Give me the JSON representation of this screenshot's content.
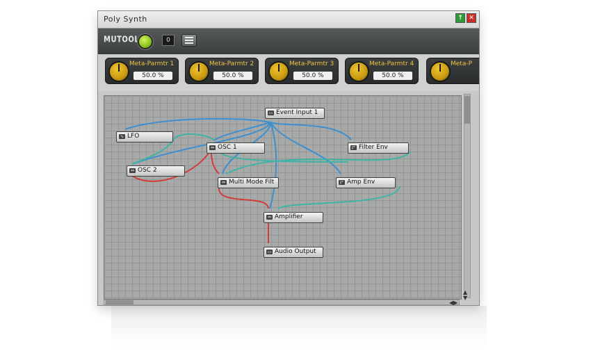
{
  "window": {
    "title": "Poly  Synth"
  },
  "toolbar": {
    "logo": "MUTOOLS",
    "program_number": "0"
  },
  "meta_params": [
    {
      "name": "Meta-Parmtr  1",
      "value": "50.0  %"
    },
    {
      "name": "Meta-Parmtr  2",
      "value": "50.0  %"
    },
    {
      "name": "Meta-Parmtr  3",
      "value": "50.0  %"
    },
    {
      "name": "Meta-Parmtr  4",
      "value": "50.0  %"
    },
    {
      "name": "Meta-P",
      "value": ""
    }
  ],
  "nodes": [
    {
      "id": "event_input",
      "label": "Event  Input  1",
      "icon": "input-icon"
    },
    {
      "id": "lfo",
      "label": "LFO",
      "icon": "lfo-icon"
    },
    {
      "id": "osc1",
      "label": "OSC  1",
      "icon": "oscillator-icon"
    },
    {
      "id": "filter_env",
      "label": "Filter  Env",
      "icon": "envelope-icon"
    },
    {
      "id": "osc2",
      "label": "OSC  2",
      "icon": "oscillator-icon"
    },
    {
      "id": "multi_mode_filt",
      "label": "Multi  Mode  Filt",
      "icon": "filter-icon"
    },
    {
      "id": "amp_env",
      "label": "Amp  Env",
      "icon": "envelope-icon"
    },
    {
      "id": "amplifier",
      "label": "Amplifier",
      "icon": "amplifier-icon"
    },
    {
      "id": "audio_output",
      "label": "Audio  Output",
      "icon": "output-icon"
    }
  ],
  "wire_colors": {
    "event": "#3d8fd0",
    "modulation": "#3fb3a6",
    "audio": "#d23c3c"
  }
}
